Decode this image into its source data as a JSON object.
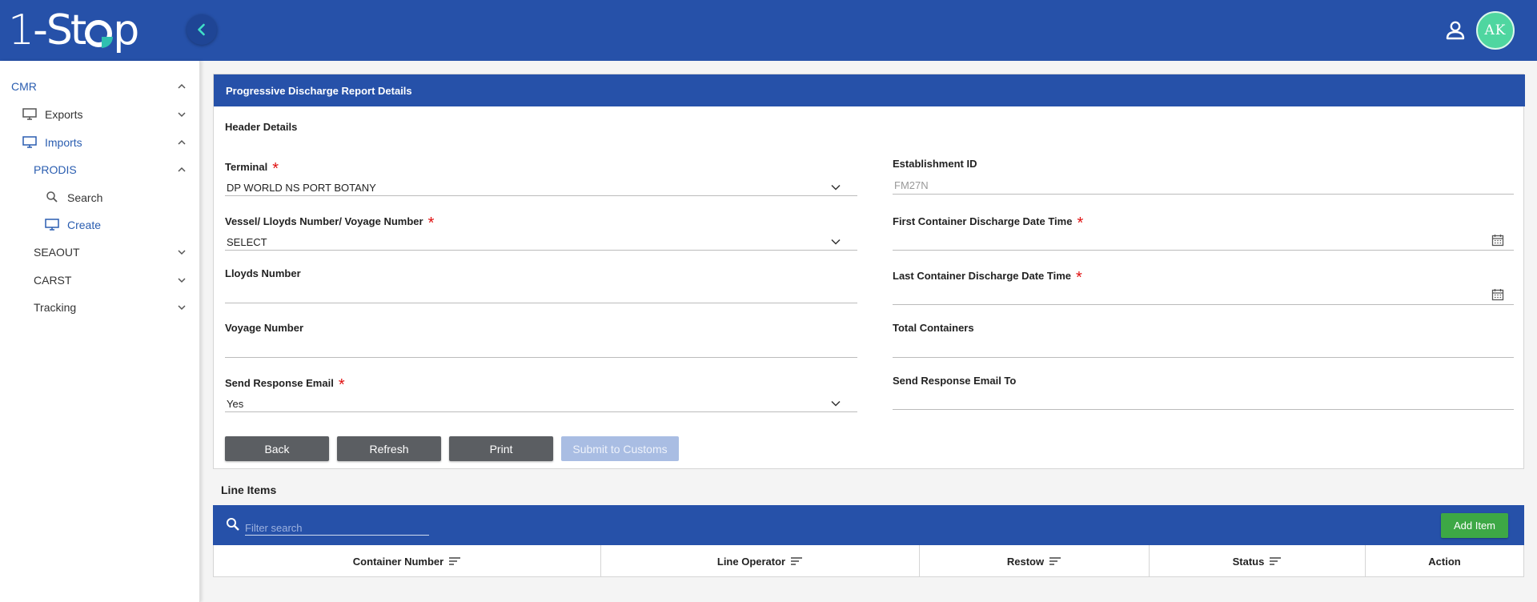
{
  "app": {
    "logo_text": "1-Stop",
    "avatar_initials": "AK"
  },
  "colors": {
    "primary": "#2651a9",
    "accent_green": "#3da845",
    "avatar": "#4fd6a0",
    "required": "#e01010"
  },
  "sidebar": {
    "items": [
      {
        "label": "CMR",
        "chevron": "up"
      },
      {
        "label": "Exports",
        "icon": "monitor-icon",
        "chevron": "down"
      },
      {
        "label": "Imports",
        "icon": "monitor-icon",
        "chevron": "up"
      },
      {
        "label": "PRODIS",
        "chevron": "up"
      },
      {
        "label": "Search",
        "icon": "search-icon"
      },
      {
        "label": "Create",
        "icon": "monitor-icon"
      },
      {
        "label": "SEAOUT",
        "chevron": "down"
      },
      {
        "label": "CARST",
        "chevron": "down"
      },
      {
        "label": "Tracking",
        "chevron": "down"
      }
    ]
  },
  "panel": {
    "title": "Progressive Discharge Report Details",
    "section_title": "Header Details",
    "fields": {
      "terminal": {
        "label": "Terminal",
        "value": "DP WORLD NS PORT BOTANY"
      },
      "establishment_id": {
        "label": "Establishment ID",
        "value": "FM27N"
      },
      "vessel": {
        "label": "Vessel/ Lloyds Number/ Voyage Number",
        "value": "SELECT"
      },
      "first_discharge": {
        "label": "First Container Discharge Date Time",
        "value": ""
      },
      "lloyds_number": {
        "label": "Lloyds Number",
        "value": ""
      },
      "last_discharge": {
        "label": "Last Container Discharge Date Time",
        "value": ""
      },
      "voyage_number": {
        "label": "Voyage Number",
        "value": ""
      },
      "total_containers": {
        "label": "Total Containers",
        "value": ""
      },
      "send_response_email": {
        "label": "Send Response Email",
        "value": "Yes"
      },
      "send_response_email_to": {
        "label": "Send Response Email To",
        "value": ""
      }
    },
    "buttons": {
      "back": "Back",
      "refresh": "Refresh",
      "print": "Print",
      "submit": "Submit to Customs"
    }
  },
  "line_items": {
    "title": "Line Items",
    "search_placeholder": "Filter search",
    "add_button": "Add Item",
    "columns": [
      "Container Number",
      "Line Operator",
      "Restow",
      "Status",
      "Action"
    ]
  }
}
